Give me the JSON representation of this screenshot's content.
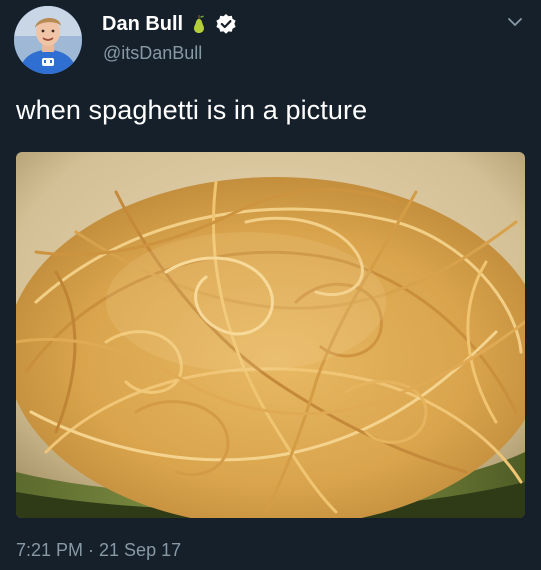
{
  "tweet": {
    "author": {
      "display_name": "Dan Bull",
      "handle": "@itsDanBull",
      "badges": [
        "pear-icon",
        "verified-icon"
      ]
    },
    "text": "when spaghetti is in a picture",
    "timestamp": "7:21 PM · 21 Sep 17",
    "menu_icon": "chevron-down-icon",
    "media": {
      "kind": "photo",
      "subject": "spaghetti-in-pot"
    }
  },
  "colors": {
    "background": "#15202b",
    "text_primary": "#ffffff",
    "text_secondary": "#8899a6",
    "avatar_shirt": "#2f6fd1",
    "pasta": "#e1b25c"
  }
}
